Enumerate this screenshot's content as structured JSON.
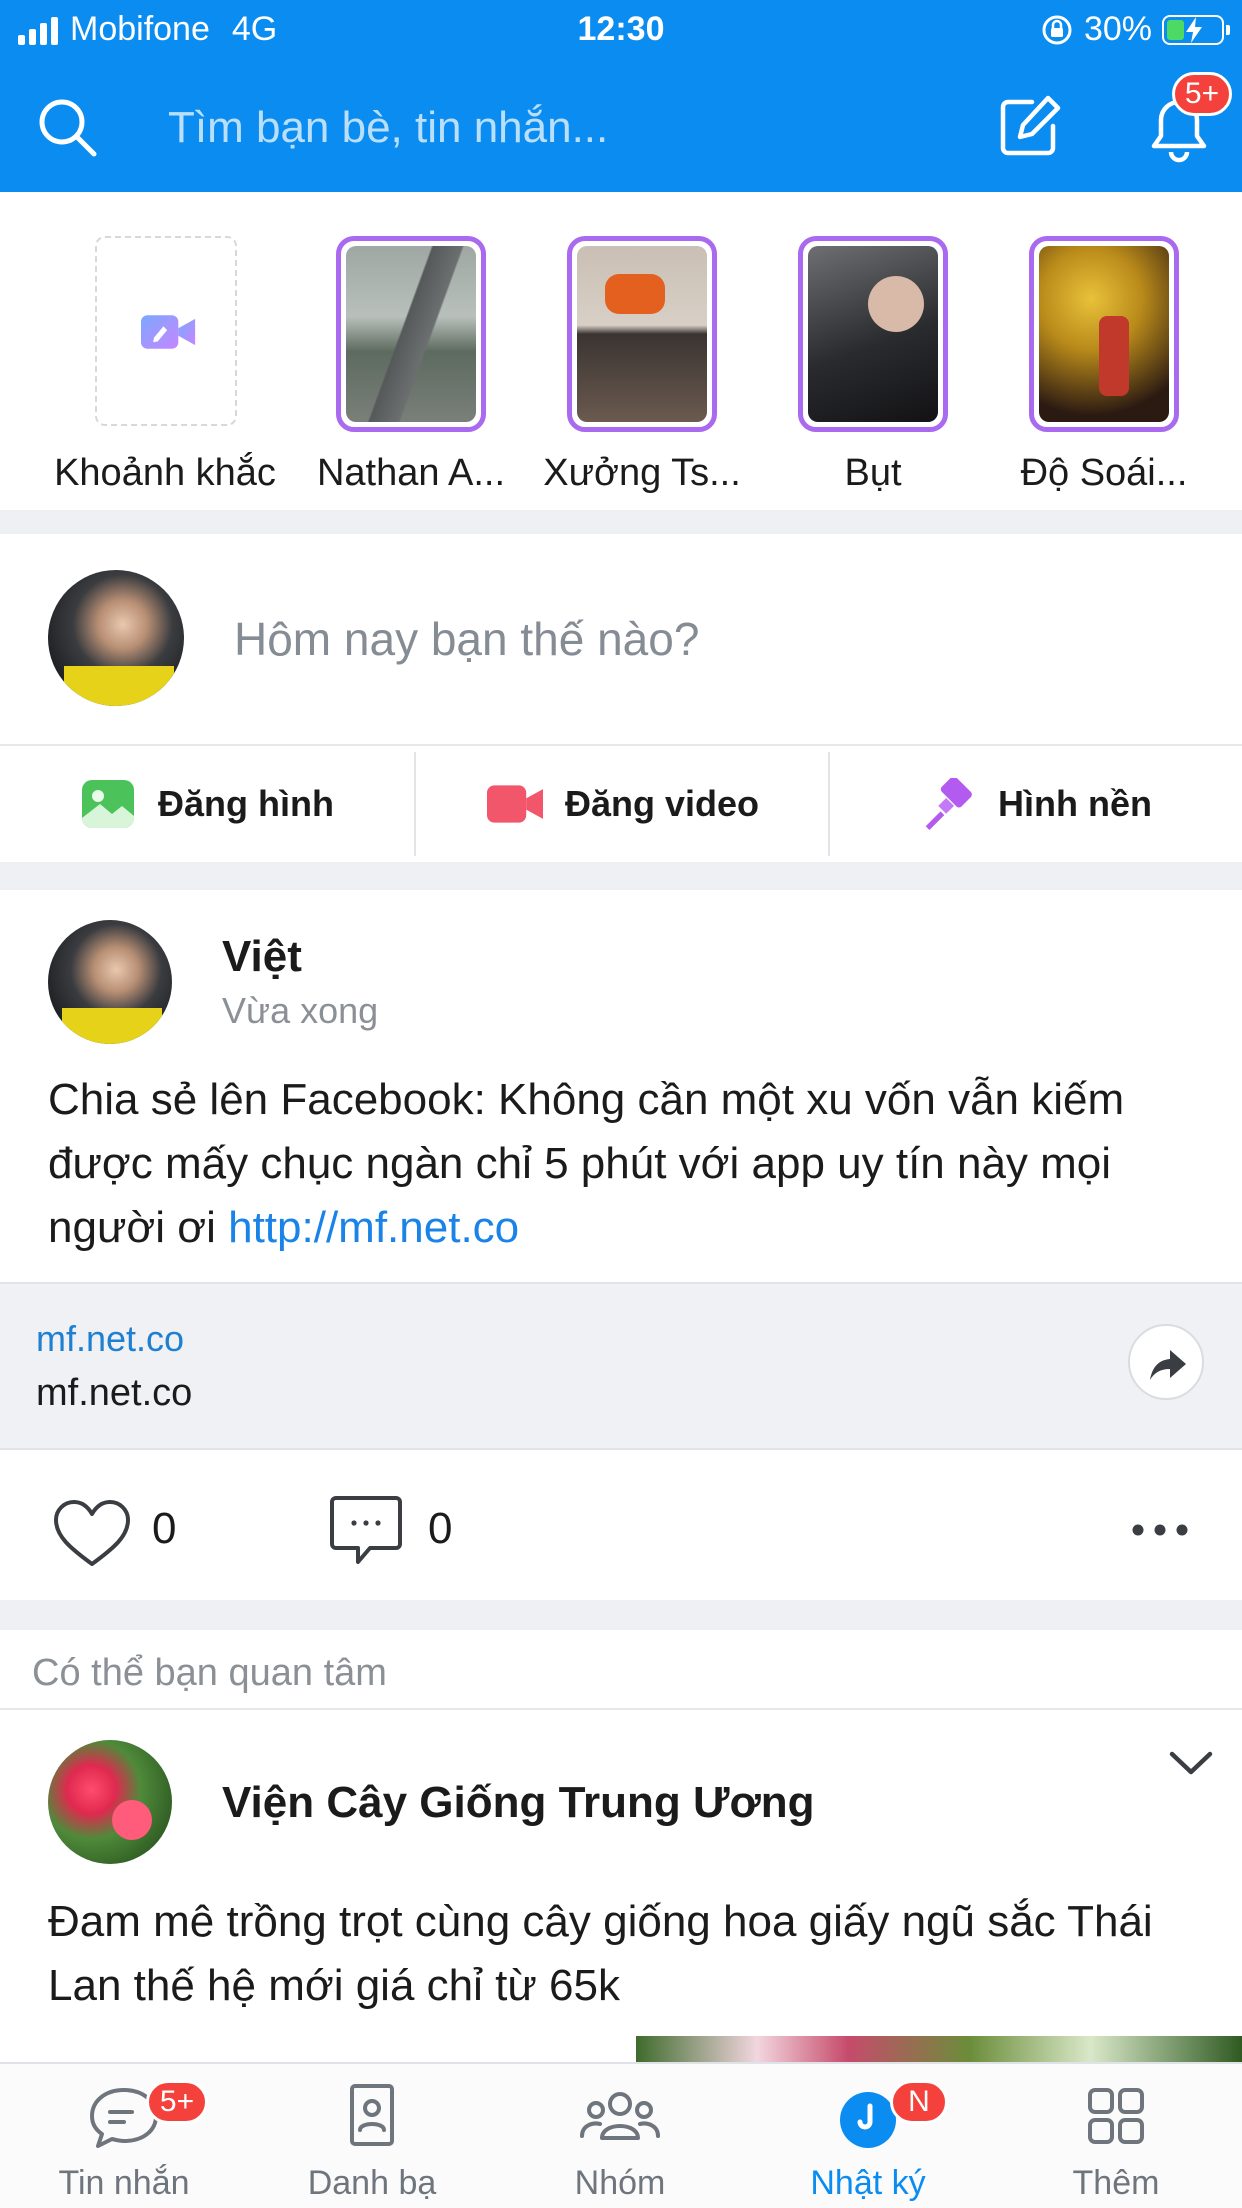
{
  "status_bar": {
    "carrier": "Mobifone",
    "network": "4G",
    "time": "12:30",
    "battery_percent": "30%",
    "battery_level": 0.3
  },
  "header": {
    "search_placeholder": "Tìm bạn bè, tin nhắn...",
    "notification_badge": "5+",
    "icons": [
      "search-icon",
      "compose-icon",
      "bell-icon"
    ]
  },
  "stories": [
    {
      "label": "Khoảnh khắc",
      "type": "add",
      "icon": "video-camera-icon"
    },
    {
      "label": "Nathan A...",
      "type": "story"
    },
    {
      "label": "Xưởng Ts...",
      "type": "story"
    },
    {
      "label": "Bụt",
      "type": "story"
    },
    {
      "label": "Độ Soái...",
      "type": "story"
    }
  ],
  "composer": {
    "prompt": "Hôm nay bạn thế nào?",
    "actions": [
      {
        "label": "Đăng hình",
        "icon": "photo-icon",
        "color": "#4cc35a"
      },
      {
        "label": "Đăng video",
        "icon": "video-icon",
        "color": "#f2566a"
      },
      {
        "label": "Hình nền",
        "icon": "paint-brush-icon",
        "color": "#b35af0"
      }
    ]
  },
  "post": {
    "author": "Việt",
    "time": "Vừa xong",
    "text": "Chia sẻ lên Facebook: Không cần một xu vốn vẫn kiếm được mấy chục ngàn chỉ 5 phút với app uy tín này mọi người ơi ",
    "link": "http://mf.net.co",
    "link_card": {
      "domain": "mf.net.co",
      "title": "mf.net.co"
    },
    "likes": "0",
    "comments": "0"
  },
  "suggested": {
    "header": "Có thể bạn quan tâm",
    "name": "Viện Cây Giống Trung Ương",
    "text": "Đam mê trồng trọt cùng cây giống hoa giấy ngũ sắc Thái Lan thế hệ mới giá chỉ từ 65k"
  },
  "bottom_nav": {
    "items": [
      {
        "label": "Tin nhắn",
        "icon": "chat-icon",
        "badge": "5+"
      },
      {
        "label": "Danh bạ",
        "icon": "contacts-icon"
      },
      {
        "label": "Nhóm",
        "icon": "group-icon"
      },
      {
        "label": "Nhật ký",
        "icon": "timeline-icon",
        "badge": "N",
        "active": true
      },
      {
        "label": "Thêm",
        "icon": "grid-icon"
      }
    ]
  },
  "colors": {
    "brand": "#0a8cf0",
    "badge": "#f5413c",
    "link": "#1a83e8",
    "story_ring": "#a96af0"
  }
}
